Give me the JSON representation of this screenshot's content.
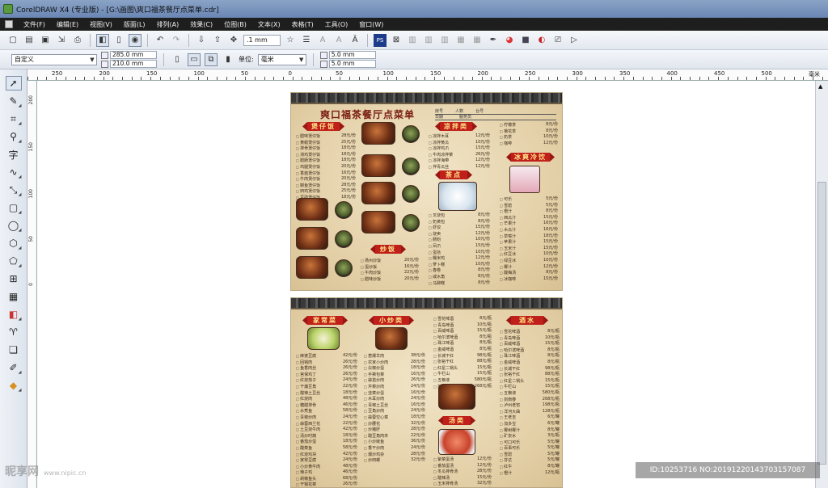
{
  "window": {
    "title": "CorelDRAW X4 (专业版) - [G:\\画图\\爽口福茶餐厅点菜单.cdr]"
  },
  "menu": [
    "文件(F)",
    "编辑(E)",
    "视图(V)",
    "版面(L)",
    "排列(A)",
    "效果(C)",
    "位图(B)",
    "文本(X)",
    "表格(T)",
    "工具(O)",
    "窗口(W)"
  ],
  "toolbar": {
    "nudge": ".1 mm"
  },
  "propbar": {
    "paper_size": "自定义",
    "width": "285.0 mm",
    "height": "210.0 mm",
    "unit_label": "单位:",
    "unit_value": "毫米",
    "dup_x": "5.0 mm",
    "dup_y": "5.0 mm"
  },
  "ruler": {
    "top_ticks": [
      "250",
      "200",
      "150",
      "100",
      "50",
      "0",
      "50",
      "100",
      "150",
      "200",
      "250",
      "300",
      "350",
      "400",
      "450",
      "500",
      "毫米"
    ],
    "left_ticks": [
      "200",
      "150",
      "100",
      "50",
      "0"
    ]
  },
  "menu_doc": {
    "headline": "爽口福茶餐厅点菜单",
    "info": [
      "房号",
      "人数",
      "台号",
      "日期",
      "服务员"
    ],
    "sections": {
      "claypot": "煲仔饭",
      "cold": "凉拌类",
      "drink": "冰爽冷饮",
      "tea": "茶点",
      "rice": "炒饭",
      "home": "家常菜",
      "stirfry": "小炒类",
      "wine": "酒水",
      "soup": "汤类"
    },
    "claypot_items": [
      [
        "腊味煲仔饭",
        "28元/份"
      ],
      [
        "黄鳝煲仔饭",
        "25元/份"
      ],
      [
        "排骨煲仔饭",
        "18元/份"
      ],
      [
        "滑鸡煲仔饭",
        "18元/份"
      ],
      [
        "腊肠煲仔饭",
        "18元/份"
      ],
      [
        "鸡腿煲仔饭",
        "20元/份"
      ],
      [
        "香菇煲仔饭",
        "16元/份"
      ],
      [
        "牛肉煲仔饭",
        "20元/份"
      ],
      [
        "鳗鱼煲仔饭",
        "28元/份"
      ],
      [
        "田鸡煲仔饭",
        "25元/份"
      ],
      [
        "豆豉煲仔饭",
        "18元/份"
      ]
    ],
    "cold_items": [
      [
        "凉拌木耳",
        "12元/份"
      ],
      [
        "凉拌黄瓜",
        "10元/份"
      ],
      [
        "凉拌鸡爪",
        "15元/份"
      ],
      [
        "牛肉凉拌菜",
        "26元/份"
      ],
      [
        "凉拌海带",
        "12元/份"
      ],
      [
        "拌青瓜丝",
        "12元/份"
      ]
    ],
    "tea_items": [
      [
        "叉烧包",
        "8元/份"
      ],
      [
        "奶黄包",
        "8元/份"
      ],
      [
        "虾饺",
        "15元/份"
      ],
      [
        "烧卖",
        "12元/份"
      ],
      [
        "肠粉",
        "10元/份"
      ],
      [
        "凤爪",
        "15元/份"
      ],
      [
        "蛋挞",
        "10元/份"
      ],
      [
        "糯米鸡",
        "12元/份"
      ],
      [
        "萝卜糕",
        "10元/份"
      ],
      [
        "春卷",
        "8元/份"
      ],
      [
        "咸水角",
        "8元/份"
      ],
      [
        "马蹄糕",
        "8元/份"
      ]
    ],
    "drink_items": [
      [
        "柠檬茶",
        "8元/份"
      ],
      [
        "菊花茶",
        "8元/份"
      ],
      [
        "奶茶",
        "10元/份"
      ],
      [
        "咖啡",
        "12元/份"
      ],
      [
        "可乐",
        "5元/份"
      ],
      [
        "雪碧",
        "5元/份"
      ],
      [
        "橙汁",
        "8元/份"
      ],
      [
        "西瓜汁",
        "15元/份"
      ],
      [
        "芒果汁",
        "16元/份"
      ],
      [
        "木瓜汁",
        "16元/份"
      ],
      [
        "草莓汁",
        "18元/份"
      ],
      [
        "苹果汁",
        "15元/份"
      ],
      [
        "玉米汁",
        "15元/份"
      ],
      [
        "红豆冰",
        "10元/份"
      ],
      [
        "绿豆冰",
        "10元/份"
      ],
      [
        "椰汁",
        "12元/份"
      ],
      [
        "酸梅汤",
        "8元/份"
      ],
      [
        "冰咖啡",
        "15元/份"
      ]
    ],
    "rice_items": [
      [
        "扬州炒饭",
        "20元/份"
      ],
      [
        "蛋炒饭",
        "16元/份"
      ],
      [
        "牛肉炒饭",
        "22元/份"
      ],
      [
        "腊味炒饭",
        "20元/份"
      ]
    ],
    "home_items": [
      [
        "麻婆豆腐",
        "42元/份"
      ],
      [
        "回锅肉",
        "26元/份"
      ],
      [
        "鱼香肉丝",
        "26元/份"
      ],
      [
        "宫保鸡丁",
        "26元/份"
      ],
      [
        "红烧茄子",
        "24元/份"
      ],
      [
        "干煸豆角",
        "22元/份"
      ],
      [
        "酸辣土豆丝",
        "18元/份"
      ],
      [
        "红烧肉",
        "48元/份"
      ],
      [
        "糖醋排骨",
        "46元/份"
      ],
      [
        "水煮鱼",
        "58元/份"
      ],
      [
        "青椒炒肉",
        "24元/份"
      ],
      [
        "蒜蓉西兰花",
        "22元/份"
      ],
      [
        "土豆烧牛肉",
        "42元/份"
      ],
      [
        "清炒时蔬",
        "18元/份"
      ],
      [
        "番茄炒蛋",
        "18元/份"
      ],
      [
        "酸菜鱼",
        "58元/份"
      ],
      [
        "红烧鸡块",
        "42元/份"
      ],
      [
        "家常豆腐",
        "24元/份"
      ],
      [
        "小炒黄牛肉",
        "48元/份"
      ],
      [
        "辣子鸡",
        "46元/份"
      ],
      [
        "剁椒鱼头",
        "68元/份"
      ],
      [
        "干锅花菜",
        "26元/份"
      ],
      [
        "干锅土豆片",
        "24元/份"
      ]
    ],
    "stirfry_items": [
      [
        "葱爆羊肉",
        "38元/份"
      ],
      [
        "农家小炒肉",
        "28元/份"
      ],
      [
        "尖椒炒蛋",
        "18元/份"
      ],
      [
        "手撕包菜",
        "16元/份"
      ],
      [
        "蒜苗炒肉",
        "26元/份"
      ],
      [
        "芹菜炒肉",
        "24元/份"
      ],
      [
        "韭菜炒蛋",
        "16元/份"
      ],
      [
        "木耳炒肉",
        "24元/份"
      ],
      [
        "青椒土豆丝",
        "16元/份"
      ],
      [
        "豆角炒肉",
        "24元/份"
      ],
      [
        "蒜蓉空心菜",
        "18元/份"
      ],
      [
        "炒腰花",
        "32元/份"
      ],
      [
        "炒猪肝",
        "28元/份"
      ],
      [
        "酸豆角肉末",
        "22元/份"
      ],
      [
        "小炒鱿鱼",
        "36元/份"
      ],
      [
        "香干炒肉",
        "24元/份"
      ],
      [
        "爆炒鸡杂",
        "28元/份"
      ],
      [
        "炒田螺",
        "32元/份"
      ]
    ],
    "wine_items": [
      [
        "雪花啤酒",
        "8元/瓶"
      ],
      [
        "青岛啤酒",
        "10元/瓶"
      ],
      [
        "百威啤酒",
        "15元/瓶"
      ],
      [
        "哈尔滨啤酒",
        "8元/瓶"
      ],
      [
        "珠江啤酒",
        "8元/瓶"
      ],
      [
        "金威啤酒",
        "8元/瓶"
      ],
      [
        "长城干红",
        "98元/瓶"
      ],
      [
        "张裕干红",
        "88元/瓶"
      ],
      [
        "红星二锅头",
        "15元/瓶"
      ],
      [
        "牛栏山",
        "15元/瓶"
      ],
      [
        "五粮液",
        "580元/瓶"
      ],
      [
        "剑南春",
        "268元/瓶"
      ],
      [
        "泸州老窖",
        "198元/瓶"
      ],
      [
        "洋河大曲",
        "128元/瓶"
      ],
      [
        "王老吉",
        "6元/罐"
      ],
      [
        "加多宝",
        "6元/罐"
      ],
      [
        "椰树椰汁",
        "8元/罐"
      ],
      [
        "矿泉水",
        "3元/瓶"
      ],
      [
        "可口可乐",
        "5元/罐"
      ],
      [
        "百事可乐",
        "5元/罐"
      ],
      [
        "雪碧",
        "5元/罐"
      ],
      [
        "芬达",
        "5元/罐"
      ],
      [
        "红牛",
        "8元/罐"
      ],
      [
        "橙汁",
        "12元/瓶"
      ]
    ],
    "soup_items": [
      [
        "紫菜蛋汤",
        "12元/份"
      ],
      [
        "番茄蛋汤",
        "12元/份"
      ],
      [
        "冬瓜排骨汤",
        "28元/份"
      ],
      [
        "酸辣汤",
        "15元/份"
      ],
      [
        "玉米排骨汤",
        "32元/份"
      ],
      [
        "老鸭汤",
        "48元/份"
      ]
    ]
  },
  "status": {
    "watermark": "ID:10253716 NO:20191220143703157087",
    "logo": "昵享网",
    "logo_url": "www.nipic.cn"
  }
}
